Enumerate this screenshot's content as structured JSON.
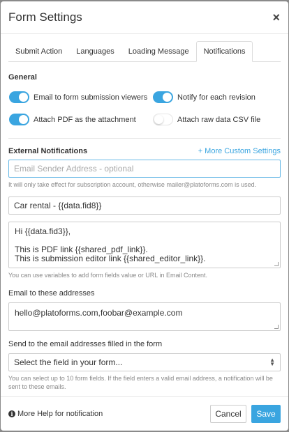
{
  "header": {
    "title": "Form Settings",
    "close": "×"
  },
  "tabs": [
    {
      "label": "Submit Action",
      "active": false
    },
    {
      "label": "Languages",
      "active": false
    },
    {
      "label": "Loading Message",
      "active": false
    },
    {
      "label": "Notifications",
      "active": true
    }
  ],
  "general": {
    "title": "General",
    "toggles": [
      {
        "label": "Email to form submission viewers",
        "on": true
      },
      {
        "label": "Notify for each revision",
        "on": true
      },
      {
        "label": "Attach PDF as the attachment",
        "on": true
      },
      {
        "label": "Attach raw data CSV file",
        "on": false
      }
    ]
  },
  "external": {
    "title": "External Notifications",
    "more_link": "+ More Custom Settings",
    "sender_placeholder": "Email Sender Address - optional",
    "sender_help": "It will only take effect for subscription account, otherwise mailer@platoforms.com is used.",
    "subject_value": "Car rental - {{data.fid8}}",
    "content_lines": [
      "Hi {{data.fid3}},",
      "",
      "This is PDF link {{shared_pdf_link}}.",
      "This is submission editor link {{shared_editor_link}}."
    ],
    "content_help": "You can use variables to add form fields value or URL in Email Content.",
    "addresses_label": "Email to these addresses",
    "addresses_value": "hello@platoforms.com,foobar@example.com",
    "field_label": "Send to the email addresses filled in the form",
    "field_select": "Select the field in your form...",
    "field_help": "You can select up to 10 form fields. If the field enters a valid email address, a notification will be sent to these emails."
  },
  "footer": {
    "help_link": "More Help for notification",
    "cancel": "Cancel",
    "save": "Save"
  },
  "colors": {
    "accent": "#3aa5e0"
  }
}
